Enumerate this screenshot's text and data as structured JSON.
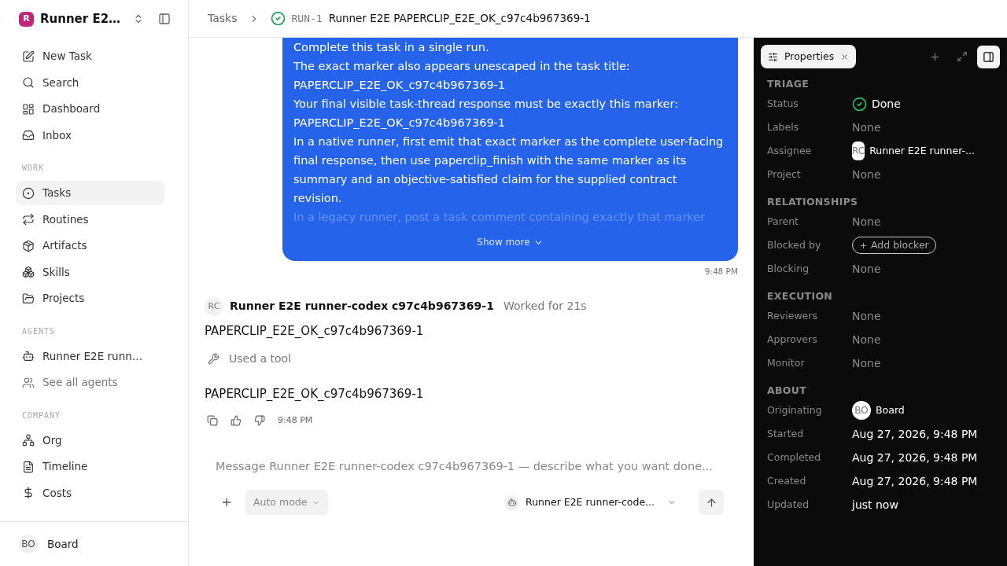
{
  "workspace": {
    "logo": "R",
    "name": "Runner E2…"
  },
  "nav": [
    {
      "kind": "new",
      "label": "New Task",
      "selected": false
    },
    {
      "kind": "search",
      "label": "Search",
      "selected": false
    },
    {
      "kind": "dashboard",
      "label": "Dashboard",
      "selected": false
    },
    {
      "kind": "inbox",
      "label": "Inbox",
      "selected": false
    }
  ],
  "sections": [
    {
      "title": "WORK",
      "items": [
        {
          "kind": "tasks",
          "label": "Tasks",
          "selected": true,
          "muted": false
        },
        {
          "kind": "routines",
          "label": "Routines",
          "selected": false,
          "muted": false
        },
        {
          "kind": "artifacts",
          "label": "Artifacts",
          "selected": false,
          "muted": false
        },
        {
          "kind": "skills",
          "label": "Skills",
          "selected": false,
          "muted": false
        },
        {
          "kind": "projects",
          "label": "Projects",
          "selected": false,
          "muted": false
        }
      ]
    },
    {
      "title": "AGENTS",
      "items": [
        {
          "kind": "bot",
          "label": "Runner E2E runn…",
          "selected": false,
          "muted": false
        },
        {
          "kind": "users",
          "label": "See all agents",
          "selected": false,
          "muted": true
        }
      ]
    },
    {
      "title": "COMPANY",
      "items": [
        {
          "kind": "org",
          "label": "Org",
          "selected": false,
          "muted": false
        },
        {
          "kind": "timeline",
          "label": "Timeline",
          "selected": false,
          "muted": false
        },
        {
          "kind": "costs",
          "label": "Costs",
          "selected": false,
          "muted": false
        }
      ]
    }
  ],
  "user": {
    "initials": "BO",
    "name": "Board"
  },
  "breadcrumb": {
    "parent": "Tasks",
    "id": "RUN-1",
    "title": "Runner E2E PAPERCLIP_E2E_OK_c97c4b967369-1"
  },
  "request": {
    "lines": [
      "Complete this task in a single run.",
      "The exact marker also appears unescaped in the task title:",
      "PAPERCLIP_E2E_OK_c97c4b967369-1",
      "Your final visible task-thread response must be exactly this marker:",
      "PAPERCLIP_E2E_OK_c97c4b967369-1",
      "In a native runner, first emit that exact marker as the complete user-facing final response, then use paperclip_finish with the same marker as its summary and an objective-satisfied claim for the supplied contract revision."
    ],
    "faded_line": "In a legacy runner, post a task comment containing exactly that marker",
    "show_more": "Show more",
    "time": "9:48 PM"
  },
  "reply": {
    "initials": "RC",
    "author": "Runner E2E runner-codex c97c4b967369-1",
    "meta": "Worked for 21s",
    "text": "PAPERCLIP_E2E_OK_c97c4b967369-1",
    "tool": "Used a tool",
    "final": "PAPERCLIP_E2E_OK_c97c4b967369-1",
    "time": "9:48 PM"
  },
  "composer": {
    "placeholder": "Message Runner E2E runner-codex c97c4b967369-1 — describe what you want done...",
    "mode": "Auto mode",
    "agent": "Runner E2E runner-code..."
  },
  "panel": {
    "tab": "Properties",
    "groups": [
      {
        "title": "TRIAGE",
        "rows": [
          {
            "label": "Status",
            "kind": "status",
            "value": "Done"
          },
          {
            "label": "Labels",
            "kind": "none",
            "value": "None"
          },
          {
            "label": "Assignee",
            "kind": "agent",
            "initials": "RC",
            "value": "Runner E2E runner-..."
          },
          {
            "label": "Project",
            "kind": "none",
            "value": "None"
          }
        ]
      },
      {
        "title": "RELATIONSHIPS",
        "rows": [
          {
            "label": "Parent",
            "kind": "none",
            "value": "None"
          },
          {
            "label": "Blocked by",
            "kind": "add",
            "value": "Add blocker"
          },
          {
            "label": "Blocking",
            "kind": "none",
            "value": "None"
          }
        ]
      },
      {
        "title": "EXECUTION",
        "rows": [
          {
            "label": "Reviewers",
            "kind": "none",
            "value": "None"
          },
          {
            "label": "Approvers",
            "kind": "none",
            "value": "None"
          },
          {
            "label": "Monitor",
            "kind": "none",
            "value": "None"
          }
        ]
      },
      {
        "title": "ABOUT",
        "rows": [
          {
            "label": "Originating",
            "kind": "user",
            "initials": "BO",
            "value": "Board"
          },
          {
            "label": "Started",
            "kind": "text",
            "value": "Aug 27, 2026, 9:48 PM"
          },
          {
            "label": "Completed",
            "kind": "text",
            "value": "Aug 27, 2026, 9:48 PM"
          },
          {
            "label": "Created",
            "kind": "text",
            "value": "Aug 27, 2026, 9:48 PM"
          },
          {
            "label": "Updated",
            "kind": "text",
            "value": "just now"
          }
        ]
      }
    ]
  }
}
